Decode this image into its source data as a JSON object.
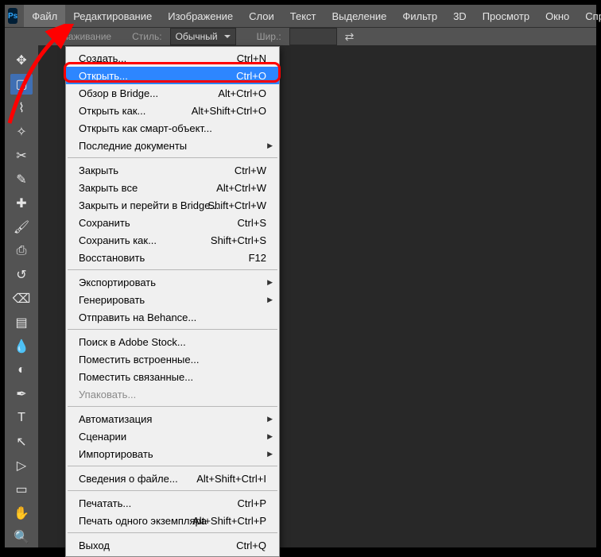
{
  "logo_text": "Ps",
  "menubar": {
    "items": [
      "Файл",
      "Редактирование",
      "Изображение",
      "Слои",
      "Текст",
      "Выделение",
      "Фильтр",
      "3D",
      "Просмотр",
      "Окно",
      "Справка"
    ],
    "active_index": 0
  },
  "options_bar": {
    "antialias_label": "Сглаживание",
    "style_label": "Стиль:",
    "style_value": "Обычный",
    "width_label": "Шир.:"
  },
  "tools": [
    {
      "name": "move-tool",
      "glyph": "✥"
    },
    {
      "name": "marquee-tool",
      "glyph": "▢",
      "selected": true
    },
    {
      "name": "lasso-tool",
      "glyph": "⌇"
    },
    {
      "name": "magic-wand-tool",
      "glyph": "✧"
    },
    {
      "name": "crop-tool",
      "glyph": "✂"
    },
    {
      "name": "eyedropper-tool",
      "glyph": "✎"
    },
    {
      "name": "healing-brush-tool",
      "glyph": "✚"
    },
    {
      "name": "brush-tool",
      "glyph": "🖌"
    },
    {
      "name": "clone-stamp-tool",
      "glyph": "⎙"
    },
    {
      "name": "history-brush-tool",
      "glyph": "↺"
    },
    {
      "name": "eraser-tool",
      "glyph": "⌫"
    },
    {
      "name": "gradient-tool",
      "glyph": "▤"
    },
    {
      "name": "blur-tool",
      "glyph": "💧"
    },
    {
      "name": "dodge-tool",
      "glyph": "◐"
    },
    {
      "name": "pen-tool",
      "glyph": "✒"
    },
    {
      "name": "type-tool",
      "glyph": "T"
    },
    {
      "name": "path-selection-tool",
      "glyph": "↖"
    },
    {
      "name": "direct-selection-tool",
      "glyph": "▷"
    },
    {
      "name": "rectangle-tool",
      "glyph": "▭"
    },
    {
      "name": "hand-tool",
      "glyph": "✋"
    },
    {
      "name": "zoom-tool",
      "glyph": "🔍"
    }
  ],
  "dropdown": {
    "groups": [
      [
        {
          "label": "Создать...",
          "shortcut": "Ctrl+N"
        },
        {
          "label": "Открыть...",
          "shortcut": "Ctrl+O",
          "highlight": true
        },
        {
          "label": "Обзор в Bridge...",
          "shortcut": "Alt+Ctrl+O"
        },
        {
          "label": "Открыть как...",
          "shortcut": "Alt+Shift+Ctrl+O"
        },
        {
          "label": "Открыть как смарт-объект..."
        },
        {
          "label": "Последние документы",
          "submenu": true
        }
      ],
      [
        {
          "label": "Закрыть",
          "shortcut": "Ctrl+W"
        },
        {
          "label": "Закрыть все",
          "shortcut": "Alt+Ctrl+W"
        },
        {
          "label": "Закрыть и перейти в Bridge...",
          "shortcut": "Shift+Ctrl+W"
        },
        {
          "label": "Сохранить",
          "shortcut": "Ctrl+S"
        },
        {
          "label": "Сохранить как...",
          "shortcut": "Shift+Ctrl+S"
        },
        {
          "label": "Восстановить",
          "shortcut": "F12"
        }
      ],
      [
        {
          "label": "Экспортировать",
          "submenu": true
        },
        {
          "label": "Генерировать",
          "submenu": true
        },
        {
          "label": "Отправить на Behance..."
        }
      ],
      [
        {
          "label": "Поиск в Adobe Stock..."
        },
        {
          "label": "Поместить встроенные..."
        },
        {
          "label": "Поместить связанные..."
        },
        {
          "label": "Упаковать...",
          "disabled": true
        }
      ],
      [
        {
          "label": "Автоматизация",
          "submenu": true
        },
        {
          "label": "Сценарии",
          "submenu": true
        },
        {
          "label": "Импортировать",
          "submenu": true
        }
      ],
      [
        {
          "label": "Сведения о файле...",
          "shortcut": "Alt+Shift+Ctrl+I"
        }
      ],
      [
        {
          "label": "Печатать...",
          "shortcut": "Ctrl+P"
        },
        {
          "label": "Печать одного экземпляра",
          "shortcut": "Alt+Shift+Ctrl+P"
        }
      ],
      [
        {
          "label": "Выход",
          "shortcut": "Ctrl+Q"
        }
      ]
    ]
  }
}
